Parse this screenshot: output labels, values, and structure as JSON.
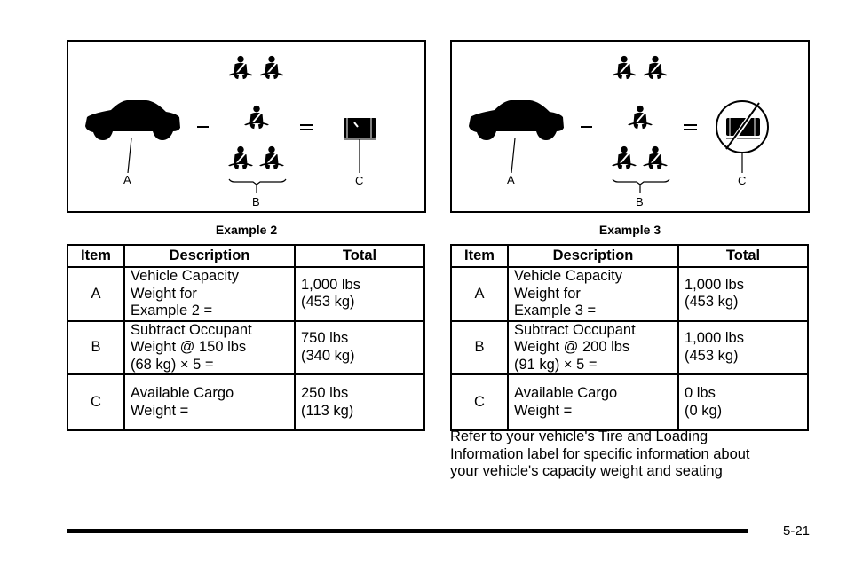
{
  "examples": [
    {
      "caption": "Example 2",
      "figure": {
        "labels": {
          "a": "A",
          "b": "B",
          "c": "C"
        },
        "operators": {
          "minus": "–",
          "equals": "="
        },
        "icons": [
          "car-icon",
          "seatbelt-occupant-icon",
          "cargo-trunk-icon"
        ],
        "occupant_count": 5
      },
      "table": {
        "headers": [
          "Item",
          "Description",
          "Total"
        ],
        "rows": [
          {
            "item": "A",
            "desc": [
              "Vehicle Capacity",
              "Weight for",
              "Example 2 ="
            ],
            "total": [
              "1,000 lbs",
              "(453 kg)"
            ]
          },
          {
            "item": "B",
            "desc": [
              "Subtract Occupant",
              "Weight @ 150 lbs",
              "(68  kg) × 5 ="
            ],
            "total": [
              "750 lbs",
              "(340 kg)"
            ]
          },
          {
            "item": "C",
            "desc": [
              "Available Cargo",
              "Weight ="
            ],
            "total": [
              "250 lbs",
              "(113 kg)"
            ]
          }
        ]
      }
    },
    {
      "caption": "Example 3",
      "figure": {
        "labels": {
          "a": "A",
          "b": "B",
          "c": "C"
        },
        "operators": {
          "minus": "–",
          "equals": "="
        },
        "icons": [
          "car-icon",
          "seatbelt-occupant-icon",
          "no-cargo-icon"
        ],
        "occupant_count": 5
      },
      "table": {
        "headers": [
          "Item",
          "Description",
          "Total"
        ],
        "rows": [
          {
            "item": "A",
            "desc": [
              "Vehicle Capacity",
              "Weight for",
              "Example 3 ="
            ],
            "total": [
              "1,000 lbs",
              "(453 kg)"
            ]
          },
          {
            "item": "B",
            "desc": [
              "Subtract Occupant",
              "Weight @ 200 lbs",
              "(91  kg) × 5 ="
            ],
            "total": [
              "1,000 lbs",
              "(453 kg)"
            ]
          },
          {
            "item": "C",
            "desc": [
              "Available Cargo",
              "Weight ="
            ],
            "total": [
              "0 lbs",
              "(0 kg)"
            ]
          }
        ]
      }
    }
  ],
  "paragraph": [
    "Refer to your vehicle's Tire and Loading",
    "Information label for specific information about",
    "your vehicle's capacity weight and seating"
  ],
  "page_number": "5-21"
}
